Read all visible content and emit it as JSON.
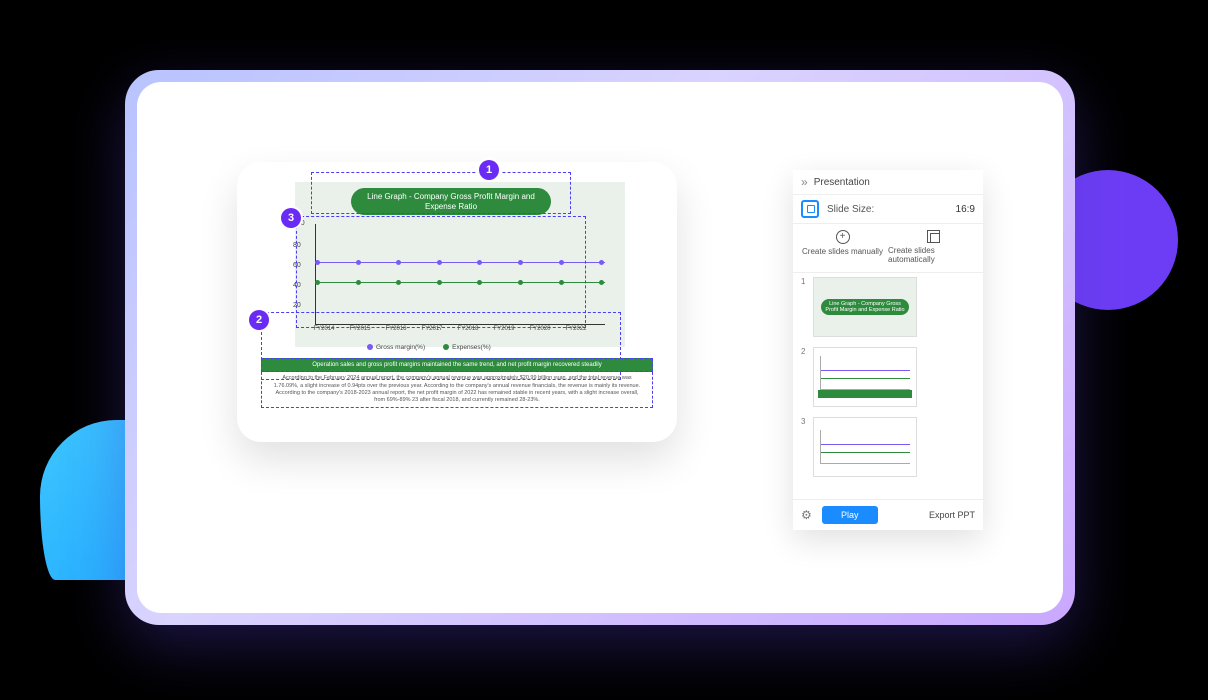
{
  "slide": {
    "title": "Line Graph - Company Gross Profit Margin and Expense Ratio",
    "footer_heading": "Operation sales and gross profit margins maintained the same trend, and net profit margin recovered steadily",
    "footer_body": "According to the February 2024 annual report, the company's annual revenue was approximately $20.99 billion yuan, and the total revenue was 1.76.09%, a slight increase of 0.94pts over the previous year. According to the company's annual revenue financials, the revenue is mainly its revenue. According to the company's 2018-2023 annual report, the net profit margin of 2022 has remained stable in recent years, with a slight increase overall, from 69%-89% 23 after fiscal 2018, and currently remained 28-23%.",
    "legend": {
      "series1": "Gross margin(%)",
      "series2": "Expenses(%)"
    },
    "axis": {
      "y": [
        "100",
        "80",
        "60",
        "40",
        "20"
      ],
      "x": [
        "FY2014",
        "FY2015",
        "FY2016",
        "FY2017",
        "FY2018",
        "FY2019",
        "FY2020",
        "FY2022"
      ]
    },
    "markers": {
      "m1": "1",
      "m2": "2",
      "m3": "3"
    }
  },
  "panel": {
    "title": "Presentation",
    "size_label": "Slide Size:",
    "size_value": "16:9",
    "action_manual": "Create slides manually",
    "action_auto": "Create slides automatically",
    "thumbs": [
      {
        "num": "1",
        "title": "Line Graph - Company Gross Profit Margin and Expense Ratio"
      },
      {
        "num": "2"
      },
      {
        "num": "3"
      }
    ],
    "play": "Play",
    "export": "Export PPT"
  },
  "chart_data": {
    "type": "line",
    "title": "Line Graph - Company Gross Profit Margin and Expense Ratio",
    "xlabel": "",
    "ylabel": "",
    "ylim": [
      0,
      100
    ],
    "categories": [
      "FY2014",
      "FY2015",
      "FY2016",
      "FY2017",
      "FY2018",
      "FY2019",
      "FY2020",
      "FY2022"
    ],
    "series": [
      {
        "name": "Gross margin(%)",
        "values": [
          62,
          62,
          61,
          62,
          62,
          61,
          62,
          62
        ]
      },
      {
        "name": "Expenses(%)",
        "values": [
          42,
          41,
          41,
          42,
          41,
          42,
          41,
          42
        ]
      }
    ]
  }
}
